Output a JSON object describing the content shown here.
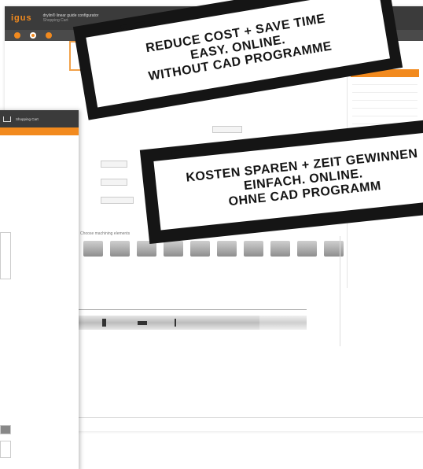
{
  "back_window": {
    "logo": "igus",
    "header_title": "drylin® linear guide configurator",
    "header_subtitle": "Shopping Cart",
    "section_title": "",
    "machining_title": "Choose machining elements",
    "machining_items": [
      "",
      "",
      "",
      "",
      "",
      "",
      "",
      "",
      "",
      ""
    ]
  },
  "front_window": {
    "tab_label": "Shopping Cart"
  },
  "sticker_en": {
    "lines": [
      "REDUCE COST + SAVE TIME",
      "EASY. ONLINE.",
      "WITHOUT CAD PROGRAMME"
    ]
  },
  "sticker_de": {
    "lines": [
      "KOSTEN SPAREN + ZEIT GEWINNEN",
      "EINFACH. ONLINE.",
      "OHNE CAD PROGRAMM"
    ]
  },
  "colors": {
    "accent": "#f28a1e",
    "header": "#3b3b3b",
    "sticker": "#151515"
  }
}
